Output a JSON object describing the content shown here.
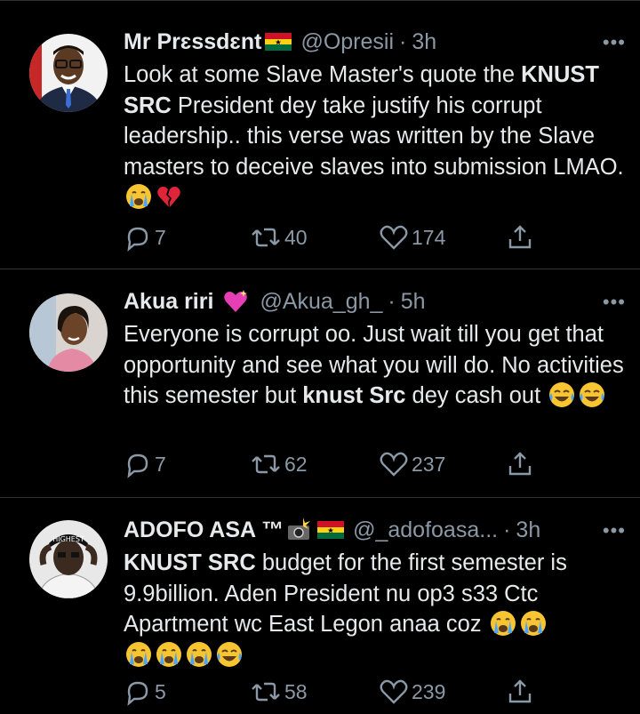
{
  "tweets": [
    {
      "name": "Mr Prɛssdɛnt",
      "handle": "@Opresii",
      "time": "3h",
      "text_before": "Look at some Slave Master's quote the ",
      "text_bold": "KNUST SRC",
      "text_after": " President dey take justify his corrupt leadership.. this verse was written by the Slave masters to deceive slaves into submission LMAO.",
      "emoji_tail": [
        "crying-emoji",
        "broken-heart-emoji"
      ],
      "replies": "7",
      "retweets": "40",
      "likes": "174"
    },
    {
      "name": "Akua riri",
      "handle": "@Akua_gh_",
      "time": "5h",
      "text_before": "Everyone is corrupt oo. Just wait till you get that opportunity and see what you will do. No activities this semester but ",
      "text_bold": "knust Src",
      "text_after": " dey cash out",
      "emoji_tail": [
        "tears-of-joy-emoji",
        "tears-of-joy-emoji"
      ],
      "replies": "7",
      "retweets": "62",
      "likes": "237"
    },
    {
      "name": "ADOFO ASA ™",
      "handle": "@_adofoasa...",
      "time": "3h",
      "text_before": "",
      "text_bold": "KNUST SRC",
      "text_after": " budget for the first semester is 9.9billion. Aden President nu op3 s33 Ctc Apartment wc East Legon anaa coz",
      "emoji_tail": [
        "crying-emoji",
        "crying-emoji",
        "crying-emoji",
        "crying-emoji",
        "crying-emoji",
        "tears-of-joy-emoji"
      ],
      "replies": "5",
      "retweets": "58",
      "likes": "239"
    }
  ],
  "colors": {
    "background": "#000000",
    "text": "#e7e9ea",
    "muted": "#8b98a5",
    "divider": "#2f3336"
  }
}
